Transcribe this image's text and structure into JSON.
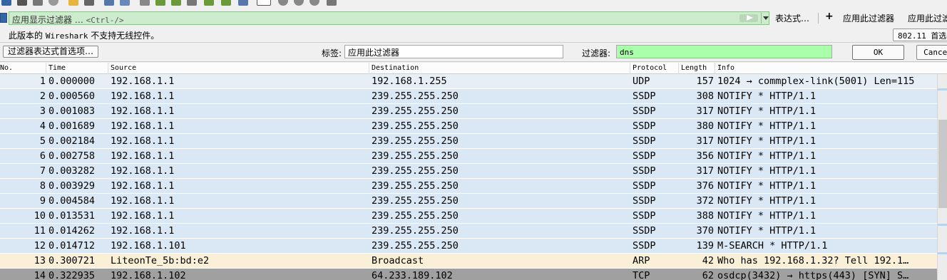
{
  "filter_bar": {
    "placeholder": "应用显示过滤器 …",
    "shortcut_hint": "<Ctrl-/>",
    "expression_label": "表达式…",
    "add_label": "+",
    "apply_filter_label_1": "应用此过滤器",
    "apply_filter_label_2": "应用此过滤"
  },
  "info_bar": {
    "message_prefix": "此版本的",
    "message_app": "Wireshark",
    "message_suffix": "不支持无线控件。",
    "interface_button": "802.11 首选"
  },
  "filter_toolbar": {
    "prefs_button": "过滤器表达式首选项…",
    "label_label": "标签:",
    "label_value": "应用此过滤器",
    "filter_label": "过滤器:",
    "filter_value": "dns",
    "ok_button": "OK",
    "cancel_button": "Cancel"
  },
  "packet_list": {
    "columns": [
      "No.",
      "Time",
      "Source",
      "Destination",
      "Protocol",
      "Length",
      "Info"
    ],
    "row_colors": {
      "udp": "#dae8f5",
      "arp": "#faf0d7",
      "tcp": "#a0a0a0",
      "selected_like": "#e6eef6"
    },
    "rows": [
      {
        "no": "1",
        "time": "0.000000",
        "src": "192.168.1.1",
        "dst": "192.168.1.255",
        "proto": "UDP",
        "len": "157",
        "info": "1024 → commplex-link(5001) Len=115",
        "color": "udp"
      },
      {
        "no": "2",
        "time": "0.000560",
        "src": "192.168.1.1",
        "dst": "239.255.255.250",
        "proto": "SSDP",
        "len": "308",
        "info": "NOTIFY * HTTP/1.1",
        "color": "udp"
      },
      {
        "no": "3",
        "time": "0.001083",
        "src": "192.168.1.1",
        "dst": "239.255.255.250",
        "proto": "SSDP",
        "len": "317",
        "info": "NOTIFY * HTTP/1.1",
        "color": "udp"
      },
      {
        "no": "4",
        "time": "0.001689",
        "src": "192.168.1.1",
        "dst": "239.255.255.250",
        "proto": "SSDP",
        "len": "380",
        "info": "NOTIFY * HTTP/1.1",
        "color": "udp"
      },
      {
        "no": "5",
        "time": "0.002184",
        "src": "192.168.1.1",
        "dst": "239.255.255.250",
        "proto": "SSDP",
        "len": "317",
        "info": "NOTIFY * HTTP/1.1",
        "color": "udp"
      },
      {
        "no": "6",
        "time": "0.002758",
        "src": "192.168.1.1",
        "dst": "239.255.255.250",
        "proto": "SSDP",
        "len": "356",
        "info": "NOTIFY * HTTP/1.1",
        "color": "udp"
      },
      {
        "no": "7",
        "time": "0.003282",
        "src": "192.168.1.1",
        "dst": "239.255.255.250",
        "proto": "SSDP",
        "len": "317",
        "info": "NOTIFY * HTTP/1.1",
        "color": "udp"
      },
      {
        "no": "8",
        "time": "0.003929",
        "src": "192.168.1.1",
        "dst": "239.255.255.250",
        "proto": "SSDP",
        "len": "376",
        "info": "NOTIFY * HTTP/1.1",
        "color": "udp"
      },
      {
        "no": "9",
        "time": "0.004584",
        "src": "192.168.1.1",
        "dst": "239.255.255.250",
        "proto": "SSDP",
        "len": "372",
        "info": "NOTIFY * HTTP/1.1",
        "color": "udp"
      },
      {
        "no": "10",
        "time": "0.013531",
        "src": "192.168.1.1",
        "dst": "239.255.255.250",
        "proto": "SSDP",
        "len": "388",
        "info": "NOTIFY * HTTP/1.1",
        "color": "udp"
      },
      {
        "no": "11",
        "time": "0.014262",
        "src": "192.168.1.1",
        "dst": "239.255.255.250",
        "proto": "SSDP",
        "len": "370",
        "info": "NOTIFY * HTTP/1.1",
        "color": "udp"
      },
      {
        "no": "12",
        "time": "0.014712",
        "src": "192.168.1.101",
        "dst": "239.255.255.250",
        "proto": "SSDP",
        "len": "139",
        "info": "M-SEARCH * HTTP/1.1",
        "color": "udp"
      },
      {
        "no": "13",
        "time": "0.300721",
        "src": "LiteonTe_5b:bd:e2",
        "dst": "Broadcast",
        "proto": "ARP",
        "len": "42",
        "info": "Who has 192.168.1.32? Tell 192.1…",
        "color": "arp"
      },
      {
        "no": "14",
        "time": "0.322935",
        "src": "192.168.1.102",
        "dst": "64.233.189.102",
        "proto": "TCP",
        "len": "62",
        "info": "osdcp(3432) → https(443) [SYN] S…",
        "color": "tcp"
      }
    ]
  }
}
